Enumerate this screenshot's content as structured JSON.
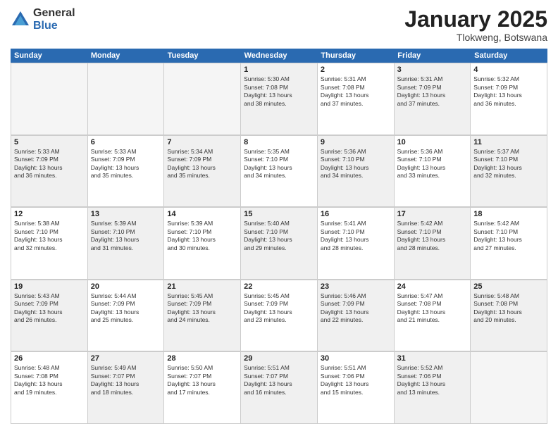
{
  "logo": {
    "general": "General",
    "blue": "Blue"
  },
  "title": "January 2025",
  "location": "Tlokweng, Botswana",
  "days_of_week": [
    "Sunday",
    "Monday",
    "Tuesday",
    "Wednesday",
    "Thursday",
    "Friday",
    "Saturday"
  ],
  "weeks": [
    [
      {
        "day": "",
        "info": "",
        "empty": true
      },
      {
        "day": "",
        "info": "",
        "empty": true
      },
      {
        "day": "",
        "info": "",
        "empty": true
      },
      {
        "day": "1",
        "info": "Sunrise: 5:30 AM\nSunset: 7:08 PM\nDaylight: 13 hours\nand 38 minutes.",
        "shaded": true
      },
      {
        "day": "2",
        "info": "Sunrise: 5:31 AM\nSunset: 7:08 PM\nDaylight: 13 hours\nand 37 minutes."
      },
      {
        "day": "3",
        "info": "Sunrise: 5:31 AM\nSunset: 7:09 PM\nDaylight: 13 hours\nand 37 minutes.",
        "shaded": true
      },
      {
        "day": "4",
        "info": "Sunrise: 5:32 AM\nSunset: 7:09 PM\nDaylight: 13 hours\nand 36 minutes."
      }
    ],
    [
      {
        "day": "5",
        "info": "Sunrise: 5:33 AM\nSunset: 7:09 PM\nDaylight: 13 hours\nand 36 minutes.",
        "shaded": true
      },
      {
        "day": "6",
        "info": "Sunrise: 5:33 AM\nSunset: 7:09 PM\nDaylight: 13 hours\nand 35 minutes."
      },
      {
        "day": "7",
        "info": "Sunrise: 5:34 AM\nSunset: 7:09 PM\nDaylight: 13 hours\nand 35 minutes.",
        "shaded": true
      },
      {
        "day": "8",
        "info": "Sunrise: 5:35 AM\nSunset: 7:10 PM\nDaylight: 13 hours\nand 34 minutes."
      },
      {
        "day": "9",
        "info": "Sunrise: 5:36 AM\nSunset: 7:10 PM\nDaylight: 13 hours\nand 34 minutes.",
        "shaded": true
      },
      {
        "day": "10",
        "info": "Sunrise: 5:36 AM\nSunset: 7:10 PM\nDaylight: 13 hours\nand 33 minutes."
      },
      {
        "day": "11",
        "info": "Sunrise: 5:37 AM\nSunset: 7:10 PM\nDaylight: 13 hours\nand 32 minutes.",
        "shaded": true
      }
    ],
    [
      {
        "day": "12",
        "info": "Sunrise: 5:38 AM\nSunset: 7:10 PM\nDaylight: 13 hours\nand 32 minutes."
      },
      {
        "day": "13",
        "info": "Sunrise: 5:39 AM\nSunset: 7:10 PM\nDaylight: 13 hours\nand 31 minutes.",
        "shaded": true
      },
      {
        "day": "14",
        "info": "Sunrise: 5:39 AM\nSunset: 7:10 PM\nDaylight: 13 hours\nand 30 minutes."
      },
      {
        "day": "15",
        "info": "Sunrise: 5:40 AM\nSunset: 7:10 PM\nDaylight: 13 hours\nand 29 minutes.",
        "shaded": true
      },
      {
        "day": "16",
        "info": "Sunrise: 5:41 AM\nSunset: 7:10 PM\nDaylight: 13 hours\nand 28 minutes."
      },
      {
        "day": "17",
        "info": "Sunrise: 5:42 AM\nSunset: 7:10 PM\nDaylight: 13 hours\nand 28 minutes.",
        "shaded": true
      },
      {
        "day": "18",
        "info": "Sunrise: 5:42 AM\nSunset: 7:10 PM\nDaylight: 13 hours\nand 27 minutes."
      }
    ],
    [
      {
        "day": "19",
        "info": "Sunrise: 5:43 AM\nSunset: 7:09 PM\nDaylight: 13 hours\nand 26 minutes.",
        "shaded": true
      },
      {
        "day": "20",
        "info": "Sunrise: 5:44 AM\nSunset: 7:09 PM\nDaylight: 13 hours\nand 25 minutes."
      },
      {
        "day": "21",
        "info": "Sunrise: 5:45 AM\nSunset: 7:09 PM\nDaylight: 13 hours\nand 24 minutes.",
        "shaded": true
      },
      {
        "day": "22",
        "info": "Sunrise: 5:45 AM\nSunset: 7:09 PM\nDaylight: 13 hours\nand 23 minutes."
      },
      {
        "day": "23",
        "info": "Sunrise: 5:46 AM\nSunset: 7:09 PM\nDaylight: 13 hours\nand 22 minutes.",
        "shaded": true
      },
      {
        "day": "24",
        "info": "Sunrise: 5:47 AM\nSunset: 7:08 PM\nDaylight: 13 hours\nand 21 minutes."
      },
      {
        "day": "25",
        "info": "Sunrise: 5:48 AM\nSunset: 7:08 PM\nDaylight: 13 hours\nand 20 minutes.",
        "shaded": true
      }
    ],
    [
      {
        "day": "26",
        "info": "Sunrise: 5:48 AM\nSunset: 7:08 PM\nDaylight: 13 hours\nand 19 minutes."
      },
      {
        "day": "27",
        "info": "Sunrise: 5:49 AM\nSunset: 7:07 PM\nDaylight: 13 hours\nand 18 minutes.",
        "shaded": true
      },
      {
        "day": "28",
        "info": "Sunrise: 5:50 AM\nSunset: 7:07 PM\nDaylight: 13 hours\nand 17 minutes."
      },
      {
        "day": "29",
        "info": "Sunrise: 5:51 AM\nSunset: 7:07 PM\nDaylight: 13 hours\nand 16 minutes.",
        "shaded": true
      },
      {
        "day": "30",
        "info": "Sunrise: 5:51 AM\nSunset: 7:06 PM\nDaylight: 13 hours\nand 15 minutes."
      },
      {
        "day": "31",
        "info": "Sunrise: 5:52 AM\nSunset: 7:06 PM\nDaylight: 13 hours\nand 13 minutes.",
        "shaded": true
      },
      {
        "day": "",
        "info": "",
        "empty": true
      }
    ]
  ]
}
